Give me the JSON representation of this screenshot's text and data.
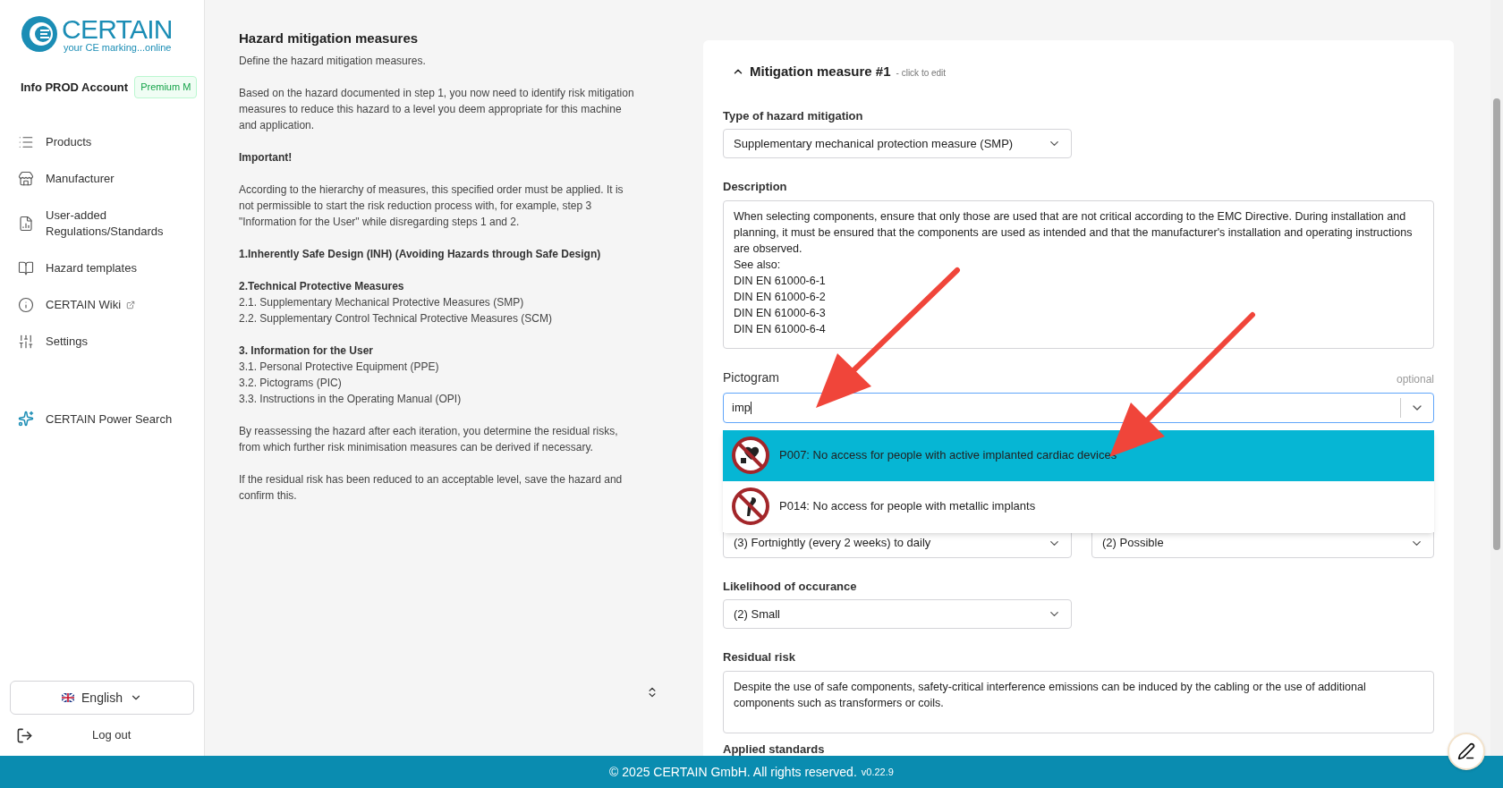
{
  "sidebar": {
    "logo": {
      "name": "CERTAIN",
      "tagline": "your CE marking...online"
    },
    "account": "Info PROD Account",
    "plan_badge": "Premium M",
    "nav": [
      {
        "label": "Products",
        "external": false
      },
      {
        "label": "Manufacturer",
        "external": false
      },
      {
        "label": "User-added Regulations/Standards",
        "external": false
      },
      {
        "label": "Hazard templates",
        "external": false
      },
      {
        "label": "CERTAIN Wiki",
        "external": true
      },
      {
        "label": "Settings",
        "external": false
      }
    ],
    "power_search": "CERTAIN Power Search",
    "language": "English",
    "logout": "Log out"
  },
  "guide": {
    "title": "Hazard mitigation measures",
    "subtitle": "Define the hazard mitigation measures.",
    "blocks": [
      {
        "kind": "paragraph",
        "text": "Based on the hazard documented in step 1, you now need to identify risk mitigation measures to reduce this hazard to a level you deem appropriate for this machine and application."
      },
      {
        "kind": "heading",
        "text": "Important!"
      },
      {
        "kind": "paragraph",
        "text": "According to the hierarchy of measures, this specified order must be applied. It is not permissible to start the risk reduction process with, for example, step 3 \"Information for the User\" while disregarding steps 1 and 2."
      },
      {
        "kind": "heading",
        "text": "1.Inherently Safe Design (INH) (Avoiding Hazards through Safe Design)"
      },
      {
        "kind": "heading",
        "text": "2.Technical Protective Measures",
        "lines": [
          "2.1. Supplementary Mechanical Protective Measures (SMP)",
          "2.2. Supplementary Control Technical Protective Measures (SCM)"
        ]
      },
      {
        "kind": "heading",
        "text": "3. Information for the User",
        "lines": [
          "3.1. Personal Protective Equipment (PPE)",
          "3.2. Pictograms (PIC)",
          "3.3. Instructions in the Operating Manual (OPI)"
        ]
      },
      {
        "kind": "paragraph",
        "text": "By reassessing the hazard after each iteration, you determine the residual risks, from which further risk minimisation measures can be derived if necessary."
      },
      {
        "kind": "paragraph",
        "text": "If the residual risk has been reduced to an acceptable level, save the hazard and confirm this."
      }
    ]
  },
  "measure": {
    "title": "Mitigation measure #1",
    "hint": "- click to edit",
    "expanded": true,
    "type": {
      "label": "Type of hazard mitigation",
      "value": "Supplementary mechanical protection measure (SMP)"
    },
    "description": {
      "label": "Description",
      "value": "When selecting components, ensure that only those are used that are not critical according to the EMC Directive. During installation and planning, it must be ensured that the components are used as intended and that the manufacturer's installation and operating instructions are observed.\nSee also:\nDIN EN 61000-6-1\nDIN EN 61000-6-2\nDIN EN 61000-6-3\nDIN EN 61000-6-4"
    },
    "pictogram": {
      "label": "Pictogram",
      "optional": "optional",
      "value": "imp",
      "options": [
        {
          "label": "P007: No access for people with active implanted cardiac devices",
          "selected": true
        },
        {
          "label": "P014: No access for people with metallic implants",
          "selected": false
        }
      ]
    },
    "frequency": {
      "value": "(3) Fortnightly (every 2 weeks) to daily"
    },
    "avoidance": {
      "value": "(2) Possible"
    },
    "likelihood": {
      "label": "Likelihood of occurance",
      "value": "(2) Small"
    },
    "residual": {
      "label": "Residual risk",
      "value": "Despite the use of safe components, safety-critical interference emissions can be induced by the cabling or the use of additional components such as transformers or coils."
    },
    "standards_label": "Applied standards"
  },
  "footer": {
    "text": "© 2025 CERTAIN GmbH. All rights reserved.",
    "version": "v0.22.9"
  }
}
